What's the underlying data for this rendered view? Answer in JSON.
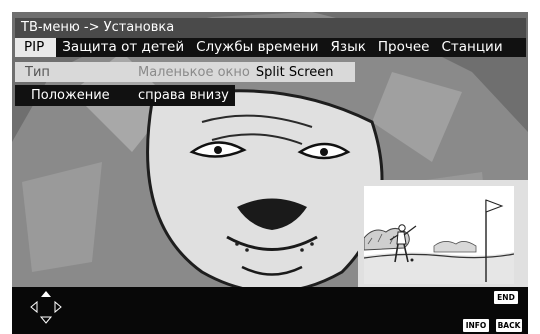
{
  "title_bar": {
    "text": "ТВ-меню -> Установка"
  },
  "menu": {
    "tabs": [
      {
        "label": "PIP",
        "active": true
      },
      {
        "label": "Защита от детей",
        "active": false
      },
      {
        "label": "Службы времени",
        "active": false
      },
      {
        "label": "Язык",
        "active": false
      },
      {
        "label": "Прочее",
        "active": false
      },
      {
        "label": "Станции",
        "active": false
      }
    ]
  },
  "settings": {
    "type": {
      "label": "Тип",
      "options": [
        "Маленькое окно",
        "Split Screen"
      ],
      "selected": "Split Screen"
    },
    "position": {
      "label": "Положение",
      "value": "справа внизу"
    }
  },
  "keys": {
    "end": "END",
    "info": "INFO",
    "back": "BACK"
  },
  "icons": {
    "navigation": "nav-arrows-icon",
    "background": "lion-illustration",
    "pip_content": "golfer-illustration"
  }
}
